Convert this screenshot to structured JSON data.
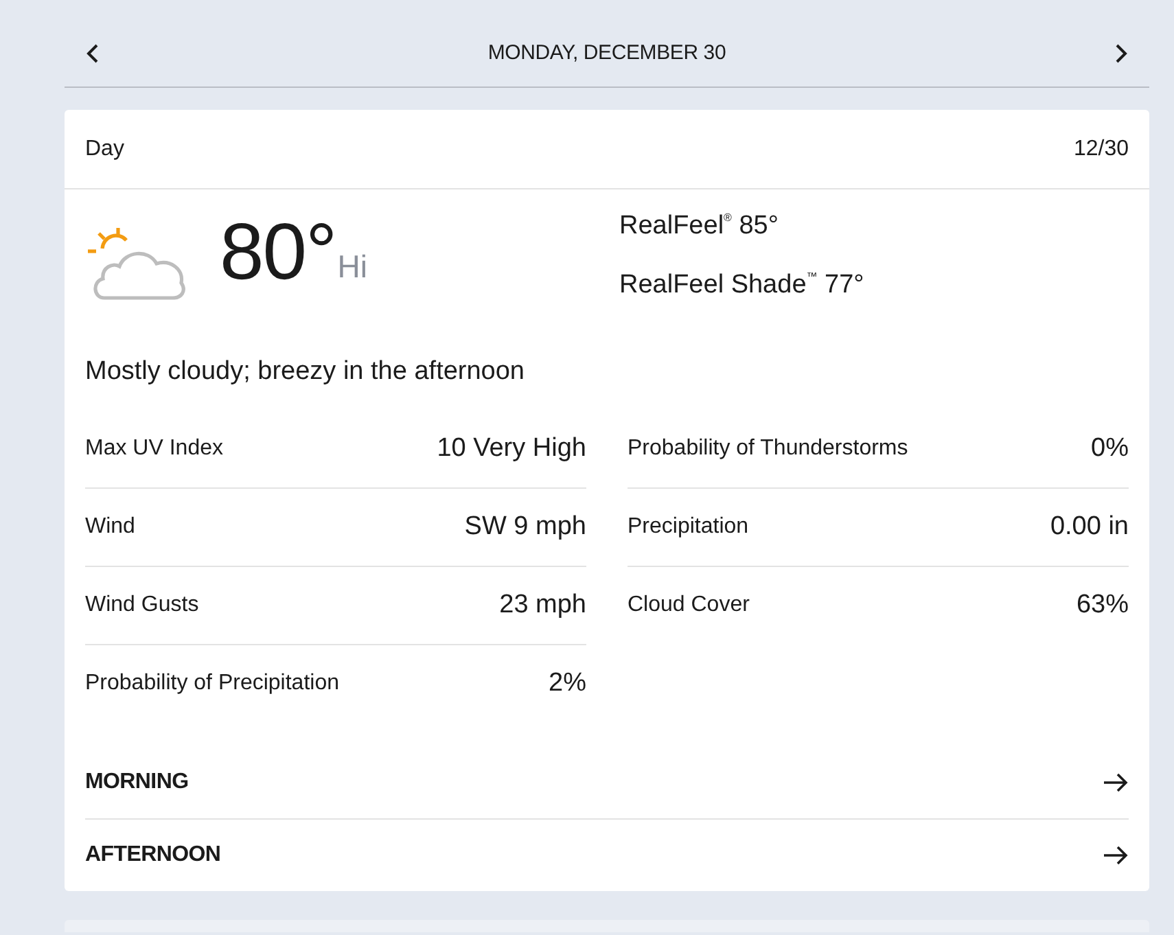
{
  "nav": {
    "title": "MONDAY, DECEMBER 30"
  },
  "card": {
    "title": "Day",
    "date": "12/30",
    "temperature": "80°",
    "temp_label": "Hi",
    "realfeel": [
      "RealFeel$^{®}$ 85°",
      "RealFeel Shade$^{™}$ 77°"
    ],
    "phrase": "Mostly cloudy; breezy in the afternoon",
    "details": [
      [
        {
          "label": "Max UV Index",
          "value": "10 Very High"
        },
        {
          "label": "Wind",
          "value": "SW 9 mph"
        },
        {
          "label": "Wind Gusts",
          "value": "23 mph"
        },
        {
          "label": "Probability of Precipitation",
          "value": "2%"
        }
      ],
      [
        {
          "label": "Probability of Thunderstorms",
          "value": "0%"
        },
        {
          "label": "Precipitation",
          "value": "0.00 in"
        },
        {
          "label": "Cloud Cover",
          "value": "63%"
        }
      ]
    ],
    "periods": [
      {
        "label": "MORNING"
      },
      {
        "label": "AFTERNOON"
      }
    ]
  }
}
